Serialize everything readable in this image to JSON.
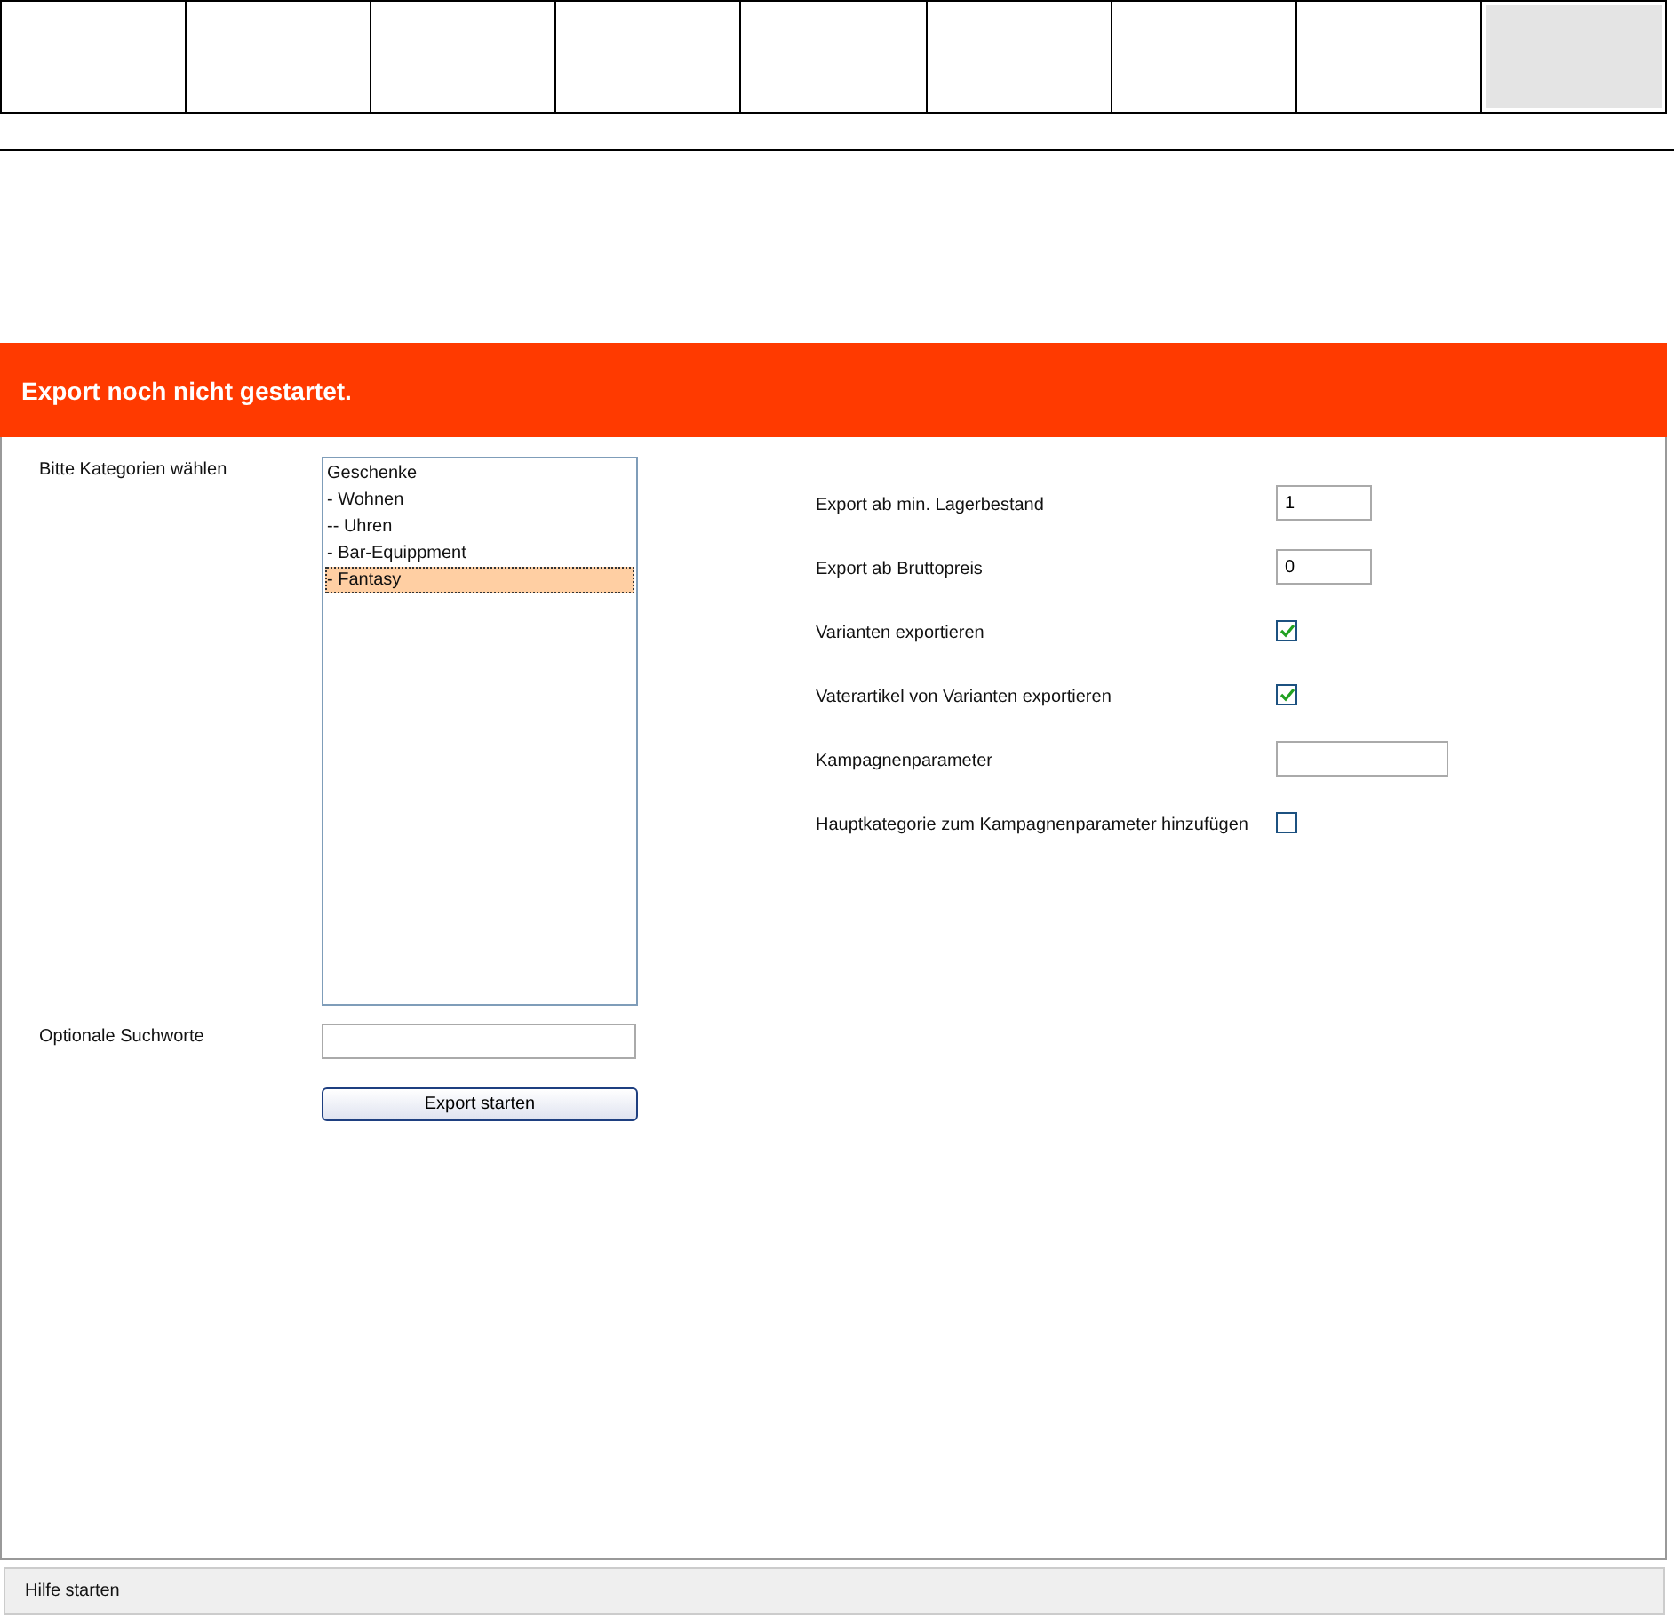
{
  "top_tabs": [
    {
      "selected": false
    },
    {
      "selected": false
    },
    {
      "selected": false
    },
    {
      "selected": false
    },
    {
      "selected": false
    },
    {
      "selected": false
    },
    {
      "selected": false
    },
    {
      "selected": false
    },
    {
      "selected": true
    }
  ],
  "status_banner": "Export noch nicht gestartet.",
  "categories": {
    "label": "Bitte Kategorien wählen",
    "items": [
      {
        "label": "Geschenke",
        "selected": false
      },
      {
        "label": "- Wohnen",
        "selected": false
      },
      {
        "label": "-- Uhren",
        "selected": false
      },
      {
        "label": "- Bar-Equippment",
        "selected": false
      },
      {
        "label": "- Fantasy",
        "selected": true
      }
    ]
  },
  "search_words": {
    "label": "Optionale Suchworte"
  },
  "export_button": "Export starten",
  "options": [
    {
      "kind": "short_input",
      "label": "Export ab min. Lagerbestand",
      "value": "1"
    },
    {
      "kind": "short_input",
      "label": "Export ab Bruttopreis",
      "value": "0"
    },
    {
      "kind": "checkbox",
      "label": "Varianten exportieren",
      "checked": true
    },
    {
      "kind": "checkbox",
      "label": "Vaterartikel von Varianten exportieren",
      "checked": true
    },
    {
      "kind": "long_input",
      "label": "Kampagnenparameter"
    },
    {
      "kind": "checkbox",
      "label": "Hauptkategorie zum Kampagnenparameter hinzufügen",
      "checked": false
    }
  ],
  "footer": "Hilfe starten"
}
